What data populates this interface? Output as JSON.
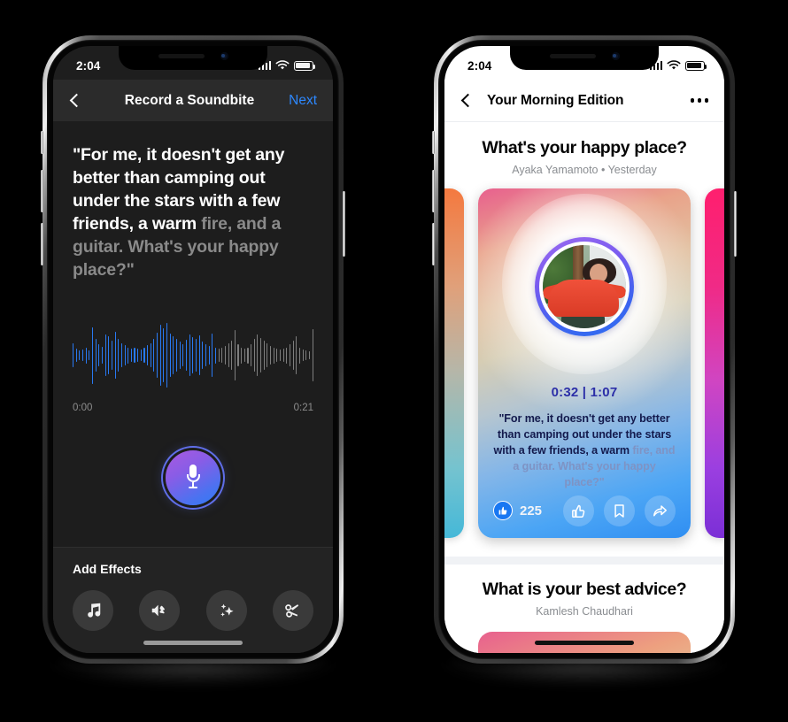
{
  "left_phone": {
    "status_bar": {
      "time": "2:04",
      "signal_icon": "signal-bars-icon",
      "wifi_icon": "wifi-icon",
      "battery_icon": "battery-icon"
    },
    "nav": {
      "back_icon": "chevron-left-icon",
      "title": "Record a Soundbite",
      "next_label": "Next"
    },
    "transcript": {
      "spoken": "\"For me, it doesn't get any better than camping out under the stars with a few friends, a warm ",
      "upcoming": "fire, and a guitar. What's your happy place?\""
    },
    "waveform": {
      "start_time": "0:00",
      "end_time": "0:21",
      "played_color": "#2979f2",
      "remaining_color": "#7e7e7e",
      "played_fraction": 0.6,
      "heights": [
        34,
        18,
        14,
        16,
        22,
        14,
        78,
        46,
        30,
        24,
        58,
        52,
        40,
        64,
        44,
        34,
        28,
        22,
        18,
        20,
        18,
        16,
        20,
        28,
        34,
        44,
        62,
        84,
        74,
        88,
        60,
        52,
        46,
        38,
        30,
        42,
        58,
        50,
        44,
        56,
        38,
        30,
        26,
        60,
        22,
        18,
        20,
        26,
        34,
        40,
        70,
        30,
        22,
        18,
        22,
        30,
        44,
        58,
        48,
        40,
        34,
        26,
        22,
        18,
        16,
        18,
        22,
        30,
        40,
        52,
        22,
        16,
        14,
        12,
        72
      ],
      "record_button": {
        "icon": "microphone-icon"
      }
    },
    "effects": {
      "title": "Add Effects",
      "items": [
        {
          "name": "music-note-icon",
          "label": "Music"
        },
        {
          "name": "voice-effect-icon",
          "label": "Voice Effects"
        },
        {
          "name": "sparkles-icon",
          "label": "Effects"
        },
        {
          "name": "scissors-icon",
          "label": "Trim"
        }
      ]
    }
  },
  "right_phone": {
    "status_bar": {
      "time": "2:04",
      "signal_icon": "signal-bars-icon",
      "wifi_icon": "wifi-icon",
      "battery_icon": "battery-icon"
    },
    "nav": {
      "back_icon": "chevron-left-icon",
      "title": "Your Morning Edition",
      "more_icon": "more-options-icon"
    },
    "post": {
      "title": "What's your happy place?",
      "meta": "Ayaka Yamamoto • Yesterday",
      "card": {
        "avatar_name": "avatar",
        "time_progress": "0:32 | 1:07",
        "transcript_spoken": "\"For me, it doesn't get any better than camping out under the stars with a few friends, a warm ",
        "transcript_upcoming": "fire, and a guitar. What's your happy place?\"",
        "like_count": "225",
        "like_badge_icon": "thumbs-up-badge-icon",
        "actions": [
          {
            "name": "like-button",
            "icon": "thumbs-up-icon"
          },
          {
            "name": "save-button",
            "icon": "bookmark-icon"
          },
          {
            "name": "share-button",
            "icon": "share-arrow-icon"
          }
        ]
      }
    },
    "post2": {
      "title": "What is your best advice?",
      "meta": "Kamlesh Chaudhari"
    }
  }
}
